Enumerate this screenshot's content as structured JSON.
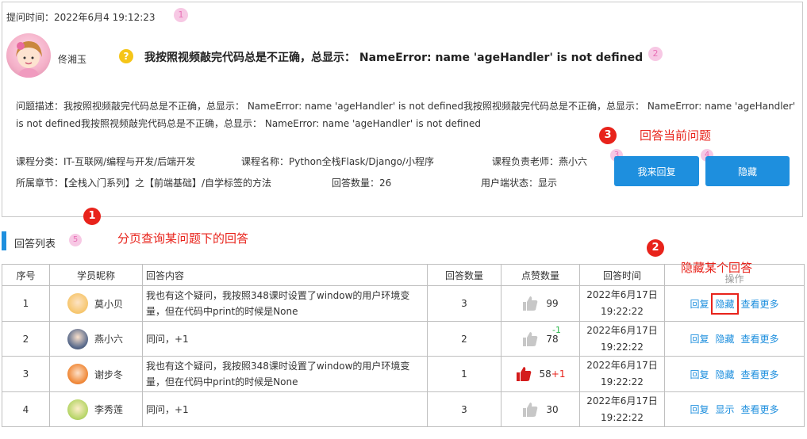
{
  "question": {
    "asked_time": "提问时间：2022年6月4 19:12:23",
    "asker_name": "佟湘玉",
    "title": "我按照视频敲完代码总是不正确，总显示： NameError: name 'ageHandler' is not defined",
    "description": "问题描述：我按照视频敲完代码总是不正确，总显示： NameError: name 'ageHandler' is not defined我按照视频敲完代码总是不正确，总显示： NameError: name 'ageHandler' is not defined我按照视频敲完代码总是不正确，总显示： NameError: name 'ageHandler' is not defined",
    "category": "课程分类：IT-互联网/编程与开发/后端开发",
    "course_name": "课程名称：Python全栈Flask/Django/小程序",
    "teacher": "课程负责老师：燕小六",
    "chapter": "所属章节：【全栈入门系列】之【前端基础】/自学标签的方法",
    "answer_count": "回答数量：26",
    "user_status": "用户端状态：显示",
    "reply_button": "我来回复",
    "hide_button": "隐藏"
  },
  "badges": {
    "b1": "1",
    "b2": "2",
    "b3": "3",
    "b4": "4",
    "b5": "5"
  },
  "markers": {
    "m1": "1",
    "m2": "2",
    "m3": "3"
  },
  "annotations": {
    "answer_current": "回答当前问题",
    "paginate": "分页查询某问题下的回答",
    "hide_answer": "隐藏某个回答"
  },
  "answer_list": {
    "title": "回答列表",
    "columns": [
      "序号",
      "学员昵称",
      "回答内容",
      "回答数量",
      "点赞数量",
      "回答时间",
      "操作"
    ],
    "rows": [
      {
        "no": "1",
        "name": "莫小贝",
        "content": "我也有这个疑问，我按照348课时设置了window的用户环境变量，但在代码中print的时候是None",
        "answers": "3",
        "likes": "99",
        "delta": "",
        "date": "2022年6月17日",
        "time": "19:22:22",
        "op1": "回复",
        "op2": "隐藏",
        "op3": "查看更多"
      },
      {
        "no": "2",
        "name": "燕小六",
        "content": "同问，+1",
        "answers": "2",
        "likes": "78",
        "delta": "-1",
        "date": "2022年6月17日",
        "time": "19:22:22",
        "op1": "回复",
        "op2": "隐藏",
        "op3": "查看更多"
      },
      {
        "no": "3",
        "name": "谢步冬",
        "content": "我也有这个疑问，我按照348课时设置了window的用户环境变量，但在代码中print的时候是None",
        "answers": "1",
        "likes": "58",
        "delta": "+1",
        "date": "2022年6月17日",
        "time": "19:22:22",
        "op1": "回复",
        "op2": "隐藏",
        "op3": "查看更多"
      },
      {
        "no": "4",
        "name": "李秀莲",
        "content": "同问，+1",
        "answers": "3",
        "likes": "30",
        "delta": "",
        "date": "2022年6月17日",
        "time": "19:22:22",
        "op1": "回复",
        "op2": "显示",
        "op3": "查看更多"
      }
    ]
  },
  "colors": {
    "accent": "#1e8fde",
    "annotation_red": "#e8231b",
    "pink_badge": "#f7c8e4"
  },
  "chart_data": {
    "type": "table",
    "columns": [
      "序号",
      "学员昵称",
      "回答内容",
      "回答数量",
      "点赞数量",
      "回答时间",
      "操作"
    ],
    "rows": [
      [
        "1",
        "莫小贝",
        "我也有这个疑问，我按照348课时设置了window的用户环境变量，但在代码中print的时候是None",
        "3",
        "99",
        "2022年6月17日 19:22:22",
        "回复 隐藏 查看更多"
      ],
      [
        "2",
        "燕小六",
        "同问，+1",
        "2",
        "78",
        "2022年6月17日 19:22:22",
        "回复 隐藏 查看更多"
      ],
      [
        "3",
        "谢步冬",
        "我也有这个疑问，我按照348课时设置了window的用户环境变量，但在代码中print的时候是None",
        "1",
        "58",
        "2022年6月17日 19:22:22",
        "回复 隐藏 查看更多"
      ],
      [
        "4",
        "李秀莲",
        "同问，+1",
        "3",
        "30",
        "2022年6月17日 19:22:22",
        "回复 显示 查看更多"
      ]
    ]
  }
}
